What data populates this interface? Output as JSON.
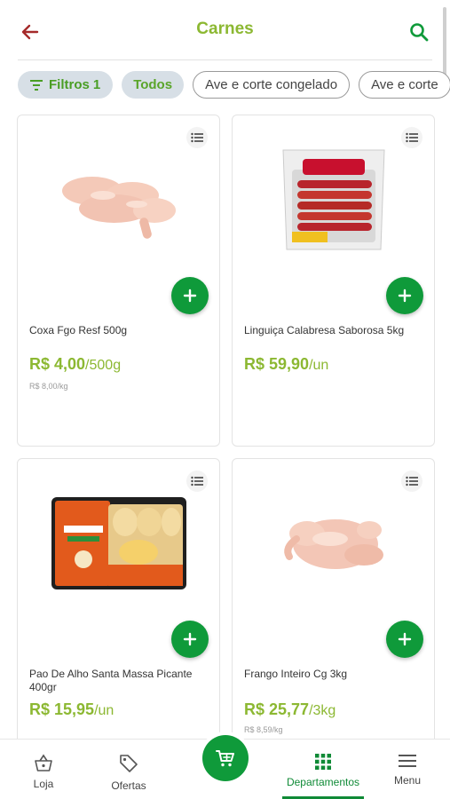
{
  "header": {
    "title": "Carnes",
    "back_icon": "arrow-left-icon",
    "search_icon": "search-icon",
    "accent_color": "#8cb832",
    "icon_color": "#a52a2a"
  },
  "filters": {
    "filter_chip": {
      "label": "Filtros",
      "count": "1"
    },
    "chips": [
      "Todos",
      "Ave e corte congelado",
      "Ave e corte"
    ]
  },
  "products": [
    {
      "name": "Coxa Fgo Resf 500g",
      "price": "R$ 4,00",
      "unit": "/500g",
      "unit_price": "R$ 8,00/kg"
    },
    {
      "name": "Linguiça Calabresa Saborosa 5kg",
      "price": "R$ 59,90",
      "unit": "/un",
      "unit_price": ""
    },
    {
      "name": "Pao De Alho Santa Massa Picante 400gr",
      "price": "R$ 15,95",
      "unit": "/un",
      "unit_price": ""
    },
    {
      "name": "Frango Inteiro Cg 3kg",
      "price": "R$ 25,77",
      "unit": "/3kg",
      "unit_price": "R$ 8,59/kg"
    }
  ],
  "bottom_nav": {
    "items": [
      {
        "label": "Loja",
        "icon": "basket-icon"
      },
      {
        "label": "Ofertas",
        "icon": "tag-icon"
      },
      {
        "label": "Departamentos",
        "icon": "grid-icon"
      },
      {
        "label": "Menu",
        "icon": "menu-icon"
      }
    ],
    "active": "Departamentos"
  },
  "colors": {
    "brand_green": "#0f9a3a",
    "price_green": "#8cb832"
  }
}
